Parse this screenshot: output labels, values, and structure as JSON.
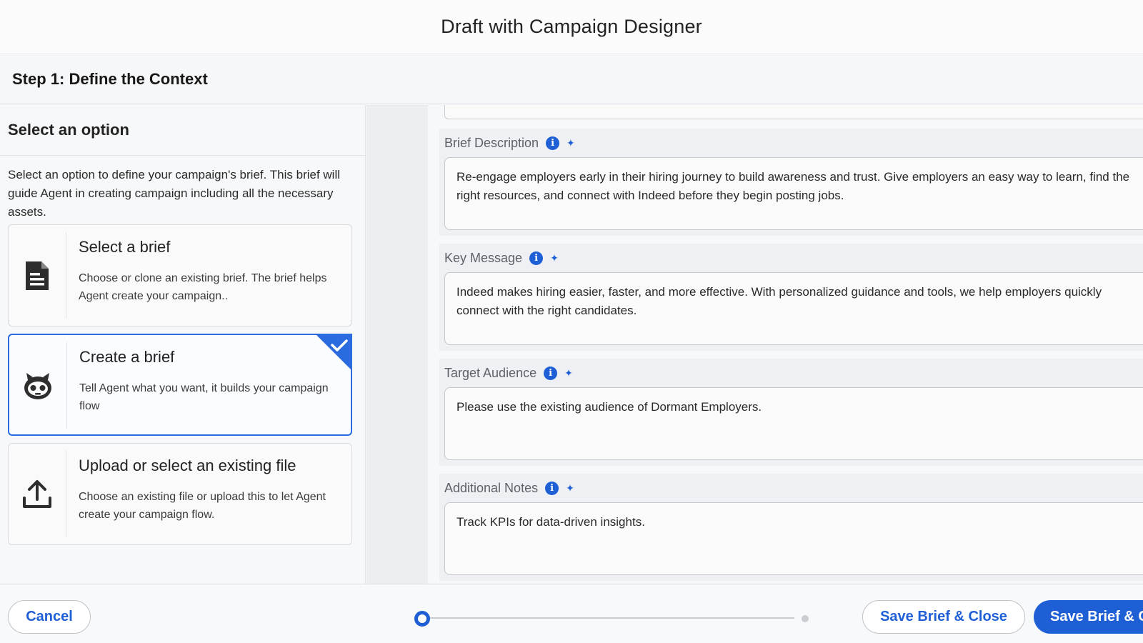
{
  "header": {
    "title": "Draft with Campaign Designer"
  },
  "step": {
    "title": "Step 1: Define the Context"
  },
  "left": {
    "heading": "Select an option",
    "description": "Select an option to define your campaign's brief. This brief will guide Agent in creating campaign including all the necessary assets.",
    "options": [
      {
        "title": "Select a brief",
        "description": "Choose or clone an existing brief. The brief helps Agent create your campaign..",
        "icon": "document-icon",
        "selected": false
      },
      {
        "title": "Create a brief",
        "description": "Tell Agent what you want, it builds your campaign flow",
        "icon": "agent-robot-icon",
        "selected": true
      },
      {
        "title": "Upload or select an existing file",
        "description": "Choose an existing file or upload this to let Agent create your campaign flow.",
        "icon": "upload-icon",
        "selected": false
      }
    ]
  },
  "fields": [
    {
      "label": "Brief Description",
      "value": "Re-engage employers early in their hiring journey to build awareness and trust. Give employers an easy way to learn, find the right resources, and connect with Indeed before they begin posting jobs."
    },
    {
      "label": "Key Message",
      "value": "Indeed makes hiring easier, faster, and more effective. With personalized guidance and tools, we help employers quickly connect with the right candidates."
    },
    {
      "label": "Target Audience",
      "value": "Please use the existing audience of Dormant Employers."
    },
    {
      "label": "Additional Notes",
      "value": "Track KPIs for data-driven insights."
    }
  ],
  "footer": {
    "cancel_label": "Cancel",
    "save_close_label": "Save Brief & Close",
    "save_continue_label": "Save Brief & C"
  },
  "colors": {
    "accent": "#1f5fd6",
    "selected_border": "#2b6be0"
  }
}
